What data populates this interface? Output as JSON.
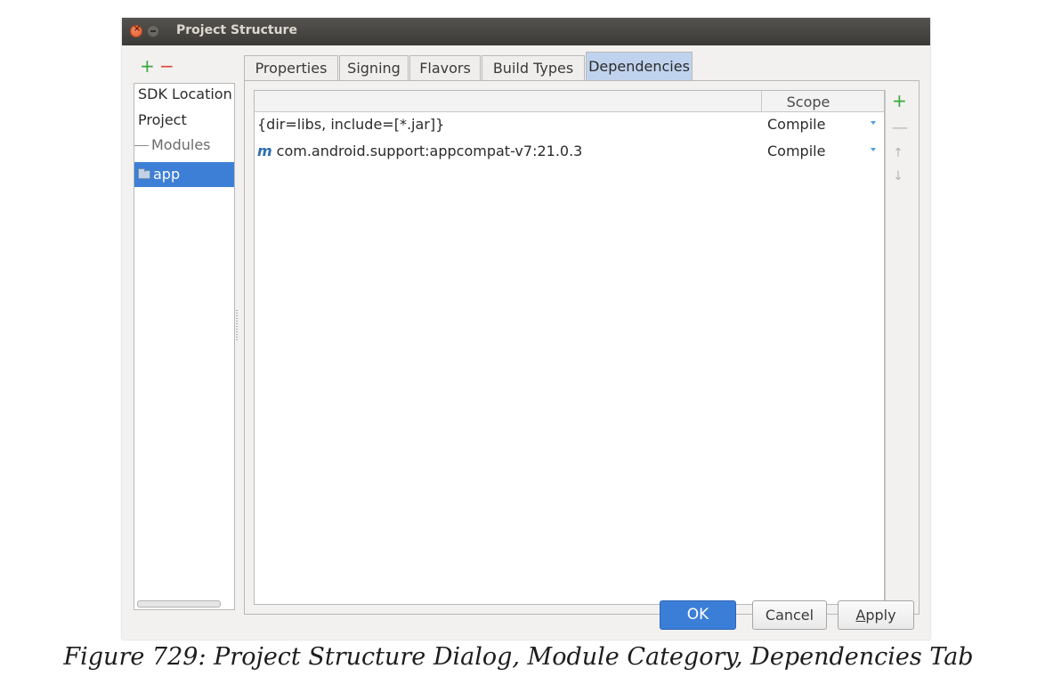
{
  "window": {
    "title": "Project Structure"
  },
  "left_toolbar": {
    "add": "+",
    "remove": "−"
  },
  "sidebar": {
    "items": [
      {
        "label": "SDK Location"
      },
      {
        "label": "Project"
      },
      {
        "label": "Modules"
      },
      {
        "label": "app"
      }
    ],
    "selected": "app"
  },
  "tabs": [
    {
      "label": "Properties"
    },
    {
      "label": "Signing"
    },
    {
      "label": "Flavors"
    },
    {
      "label": "Build Types"
    },
    {
      "label": "Dependencies"
    }
  ],
  "active_tab": "Dependencies",
  "dependencies": {
    "columns": {
      "name": "",
      "scope": "Scope"
    },
    "rows": [
      {
        "icon": "",
        "name": "{dir=libs, include=[*.jar]}",
        "scope": "Compile"
      },
      {
        "icon": "m",
        "name": "com.android.support:appcompat-v7:21.0.3",
        "scope": "Compile"
      }
    ],
    "side_buttons": {
      "add": "+",
      "remove": "—",
      "up": "↑",
      "down": "↓"
    }
  },
  "buttons": {
    "ok": "OK",
    "cancel": "Cancel",
    "apply_mnemonic": "A",
    "apply_rest": "pply"
  },
  "caption": "Figure 729: Project Structure Dialog, Module Category, Dependencies Tab",
  "colors": {
    "selection": "#3d7fd6",
    "active_tab": "#c0d3ee",
    "ok_button": "#3b7ed8"
  }
}
